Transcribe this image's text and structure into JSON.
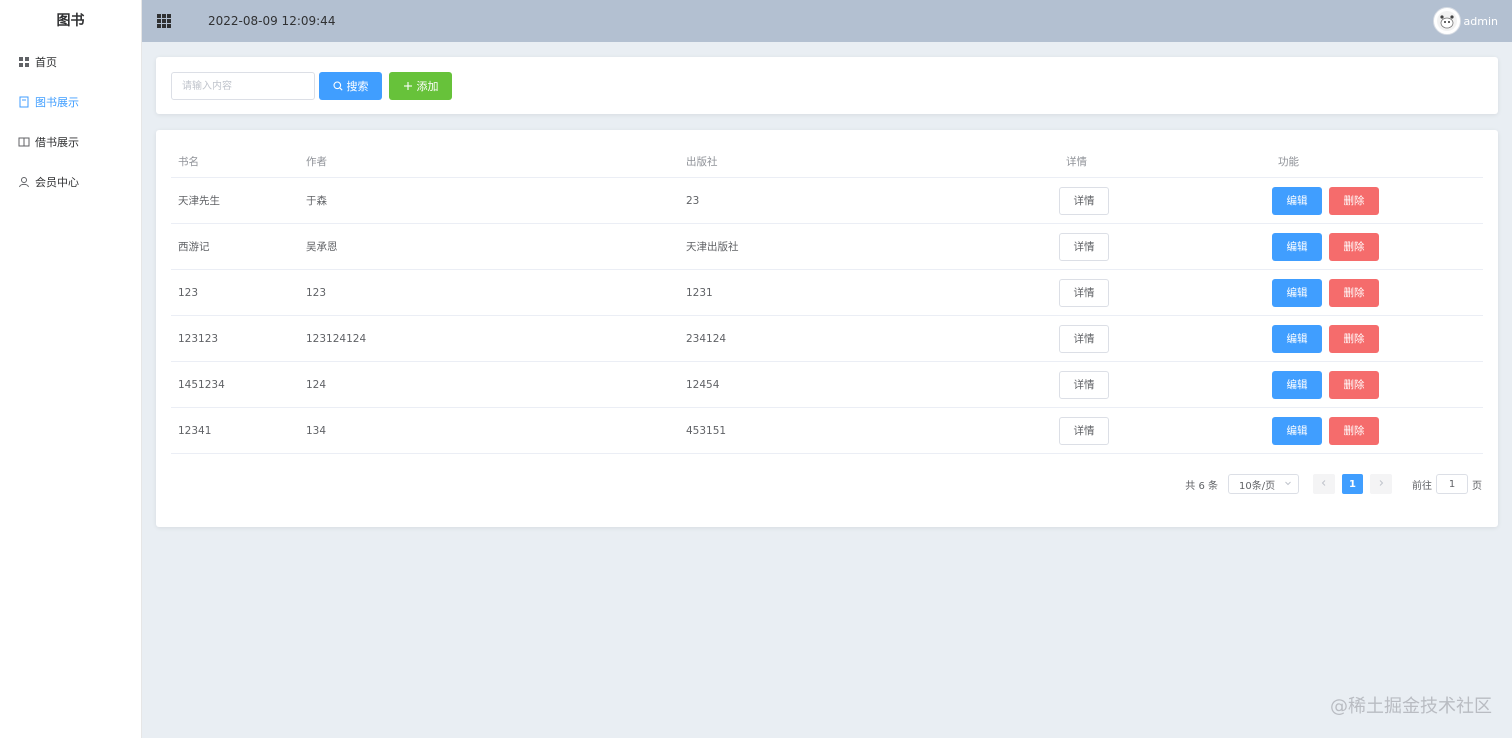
{
  "sidebar": {
    "brand": "图书",
    "items": [
      {
        "label": "首页",
        "icon": "grid-icon",
        "active": false
      },
      {
        "label": "图书展示",
        "icon": "book-icon",
        "active": true
      },
      {
        "label": "借书展示",
        "icon": "open-book-icon",
        "active": false
      },
      {
        "label": "会员中心",
        "icon": "user-icon",
        "active": false
      }
    ]
  },
  "header": {
    "datetime": "2022-08-09 12:09:44",
    "username": "admin"
  },
  "search": {
    "placeholder": "请输入内容",
    "value": "",
    "search_label": "搜索",
    "add_label": "添加"
  },
  "table": {
    "columns": [
      "书名",
      "作者",
      "出版社",
      "详情",
      "功能"
    ],
    "rows": [
      {
        "name": "天津先生",
        "author": "于森",
        "publisher": "23"
      },
      {
        "name": "西游记",
        "author": "吴承恩",
        "publisher": "天津出版社"
      },
      {
        "name": "123",
        "author": "123",
        "publisher": "1231"
      },
      {
        "name": "123123",
        "author": "123124124",
        "publisher": "234124"
      },
      {
        "name": "1451234",
        "author": "124",
        "publisher": "12454"
      },
      {
        "name": "12341",
        "author": "134",
        "publisher": "453151"
      }
    ],
    "detail_label": "详情",
    "edit_label": "编辑",
    "delete_label": "删除"
  },
  "pagination": {
    "total": "共 6 条",
    "page_size": "10条/页",
    "current_page": "1",
    "goto_label": "前往",
    "goto_value": "1",
    "page_suffix": "页"
  },
  "watermark": "@稀土掘金技术社区",
  "colors": {
    "primary": "#409eff",
    "success": "#67c23a",
    "danger": "#f56c6c",
    "header_bg": "#b3c0d1",
    "main_bg": "#e9eef3"
  }
}
